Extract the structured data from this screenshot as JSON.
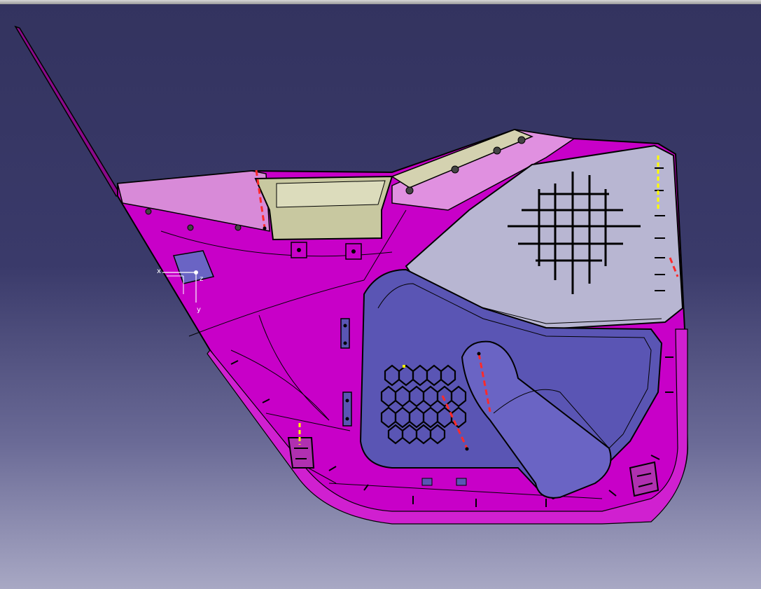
{
  "viewer": {
    "background_top": "#33335f",
    "background_bottom": "#a8a8c4",
    "part_colors": {
      "door_panel": "#c800c8",
      "door_panel_highlight": "#e23ce2",
      "armrest_pocket": "#5a55b4",
      "map_pocket_cover": "#b8b6d2",
      "handle_insert": "#c8c8a0",
      "edges": "#000000"
    }
  },
  "compass": {
    "axis_x": "x",
    "axis_y": "y",
    "axis_z": "z",
    "icon": "axis-triad-icon"
  }
}
